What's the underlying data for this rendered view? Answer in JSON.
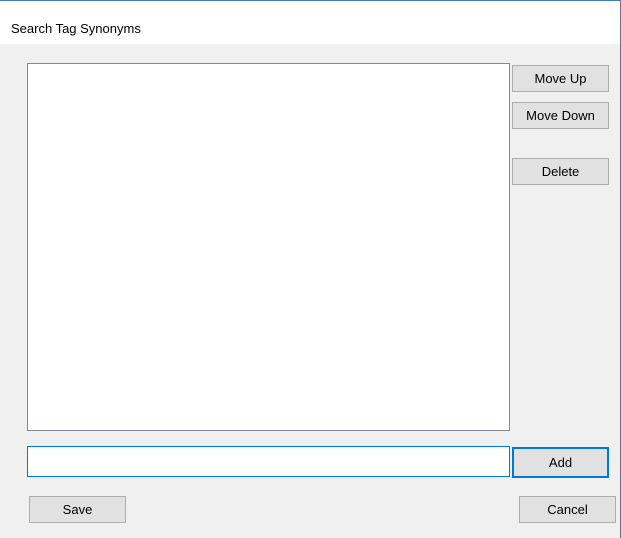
{
  "window": {
    "title": "Search Tag Synonyms"
  },
  "list": {
    "items": []
  },
  "buttons": {
    "move_up": "Move Up",
    "move_down": "Move Down",
    "delete": "Delete",
    "add": "Add",
    "save": "Save",
    "cancel": "Cancel"
  },
  "input": {
    "value": "",
    "placeholder": ""
  },
  "colors": {
    "background": "#f0f0f0",
    "titlebar": "#ffffff",
    "focus_border": "#0078d7",
    "button_face": "#e1e1e1",
    "button_border": "#adadad"
  }
}
